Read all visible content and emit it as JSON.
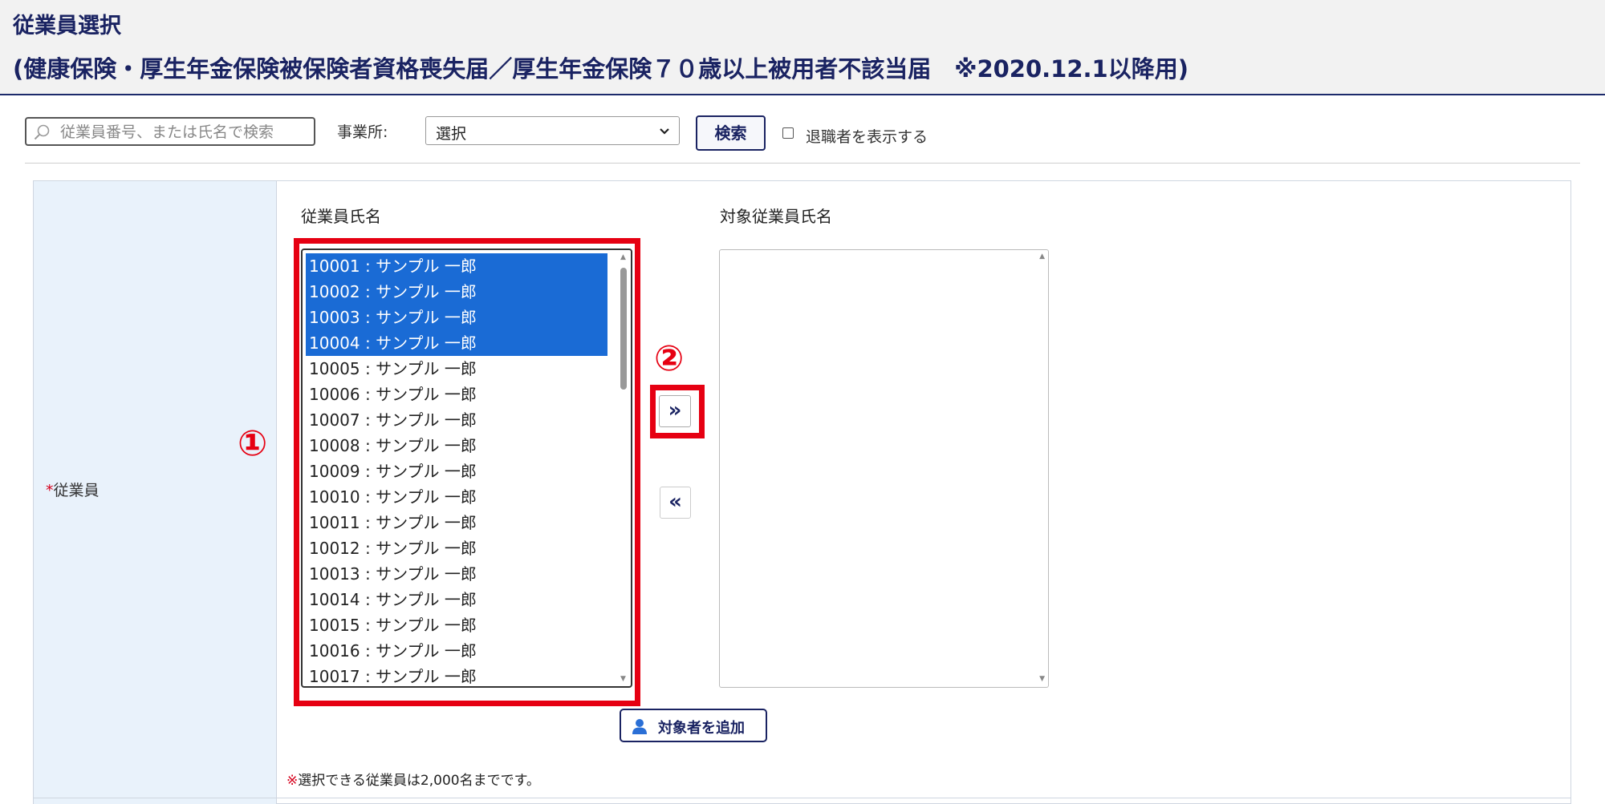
{
  "header": {
    "title": "従業員選択",
    "subtitle": "(健康保険・厚生年金保険被保険者資格喪失届／厚生年金保険７０歳以上被用者不該当届　※2020.12.1以降用)"
  },
  "search": {
    "placeholder": "従業員番号、または氏名で検索",
    "office_label": "事業所:",
    "office_selected": "選択",
    "button_label": "検索",
    "retired_label": "退職者を表示する",
    "retired_checked": false
  },
  "form": {
    "required_mark": "*",
    "employee_label": "従業員",
    "left_header": "従業員氏名",
    "right_header": "対象従業員氏名",
    "employees": [
      {
        "label": "10001 : サンプル 一郎",
        "selected": true
      },
      {
        "label": "10002 : サンプル 一郎",
        "selected": true
      },
      {
        "label": "10003 : サンプル 一郎",
        "selected": true
      },
      {
        "label": "10004 : サンプル 一郎",
        "selected": true
      },
      {
        "label": "10005 : サンプル 一郎",
        "selected": false
      },
      {
        "label": "10006 : サンプル 一郎",
        "selected": false
      },
      {
        "label": "10007 : サンプル 一郎",
        "selected": false
      },
      {
        "label": "10008 : サンプル 一郎",
        "selected": false
      },
      {
        "label": "10009 : サンプル 一郎",
        "selected": false
      },
      {
        "label": "10010 : サンプル 一郎",
        "selected": false
      },
      {
        "label": "10011 : サンプル 一郎",
        "selected": false
      },
      {
        "label": "10012 : サンプル 一郎",
        "selected": false
      },
      {
        "label": "10013 : サンプル 一郎",
        "selected": false
      },
      {
        "label": "10014 : サンプル 一郎",
        "selected": false
      },
      {
        "label": "10015 : サンプル 一郎",
        "selected": false
      },
      {
        "label": "10016 : サンプル 一郎",
        "selected": false
      },
      {
        "label": "10017 : サンプル 一郎",
        "selected": false
      }
    ],
    "move_right_label": "»",
    "move_left_label": "«",
    "add_button_label": "対象者を追加",
    "note_mark": "※",
    "note_text": "選択できる従業員は2,000名までです。"
  },
  "annotations": {
    "marker1": "①",
    "marker2": "②"
  },
  "colors": {
    "brand_navy": "#1a2362",
    "selection_blue": "#1a6bd5",
    "annotation_red": "#e60012",
    "label_bg": "#e9f2fb"
  },
  "icons": {
    "search": "search-icon",
    "user": "user-icon",
    "chevron": "chevron-down-icon"
  }
}
